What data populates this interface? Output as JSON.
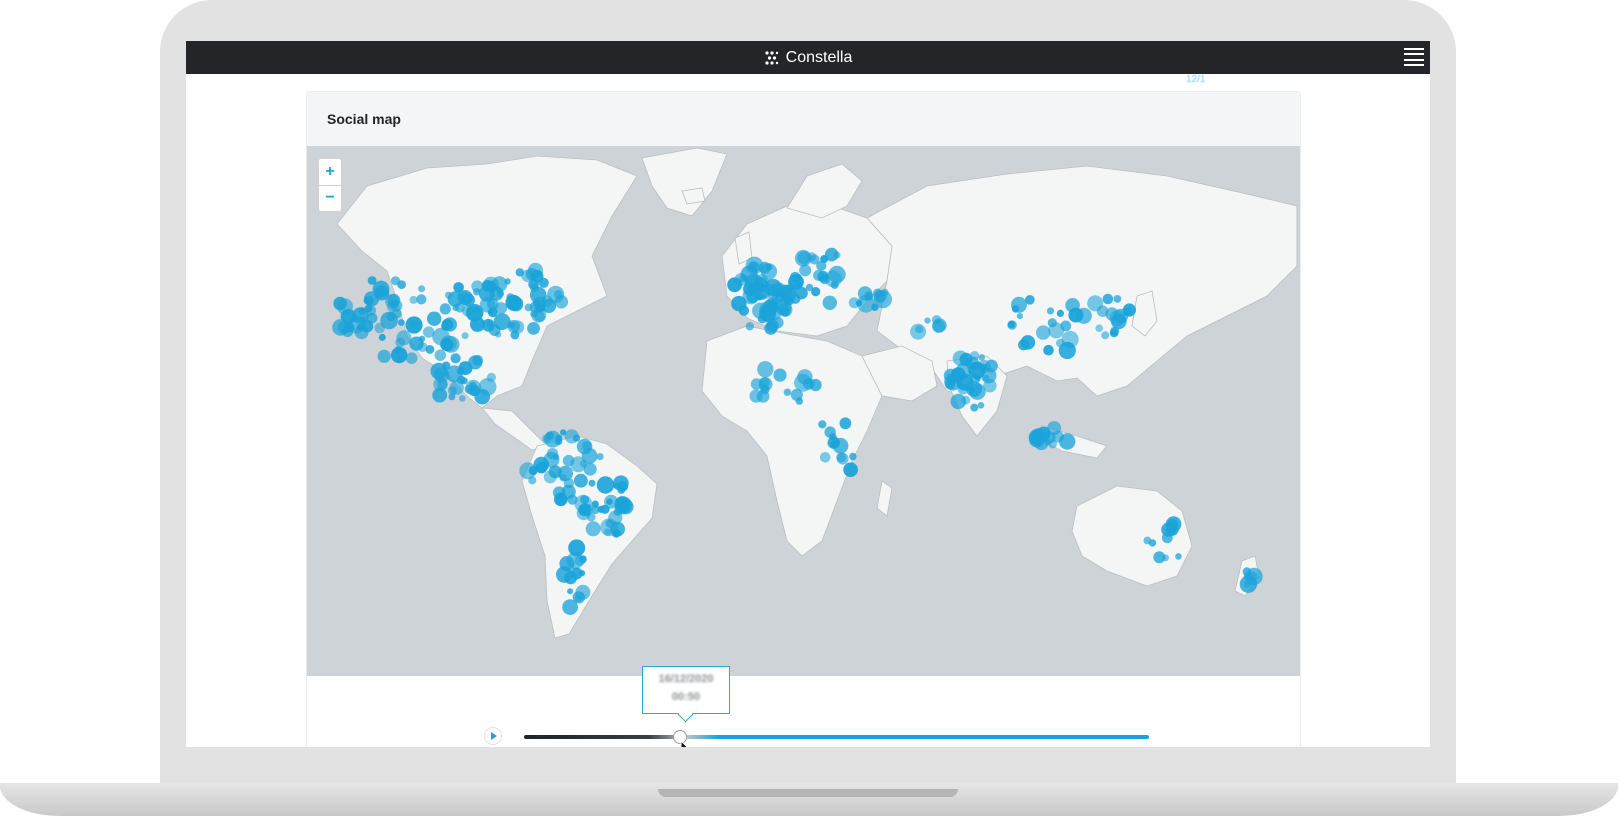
{
  "app": {
    "brand_name": "Constella"
  },
  "header_overflow_text": "12/1",
  "card": {
    "title": "Social map"
  },
  "map": {
    "zoom_in_label": "+",
    "zoom_out_label": "−",
    "colors": {
      "ocean": "#cdd3d6",
      "land": "#f4f5f5",
      "border": "#b9bfc3",
      "dot": "#1aa3d9"
    }
  },
  "timeline": {
    "tooltip_date": "16/12/2020",
    "tooltip_time": "00:50",
    "progress_fraction": 0.26
  },
  "icons": {
    "brand": "constella-logo-icon",
    "menu": "hamburger-menu-icon",
    "play": "play-icon",
    "cursor": "mouse-pointer-icon"
  }
}
